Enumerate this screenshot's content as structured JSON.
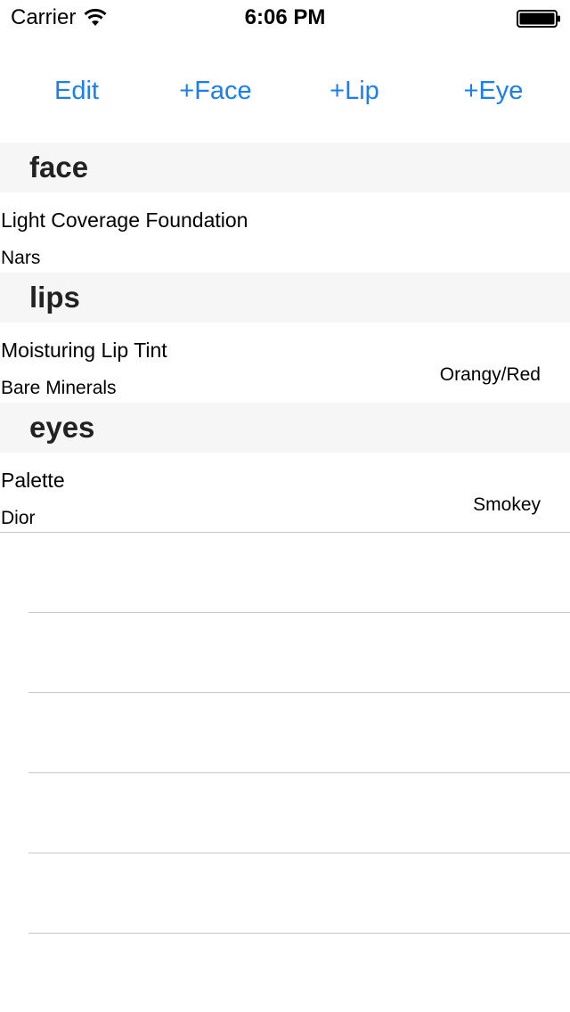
{
  "status_bar": {
    "carrier": "Carrier",
    "time": "6:06 PM"
  },
  "toolbar": {
    "edit_label": "Edit",
    "add_face_label": "+Face",
    "add_lip_label": "+Lip",
    "add_eye_label": "+Eye"
  },
  "sections": [
    {
      "header": "face",
      "items": [
        {
          "name": "Light Coverage Foundation",
          "brand": "Nars",
          "detail": ""
        }
      ]
    },
    {
      "header": "lips",
      "items": [
        {
          "name": "Moisturing Lip Tint",
          "brand": "Bare Minerals",
          "detail": "Orangy/Red"
        }
      ]
    },
    {
      "header": "eyes",
      "items": [
        {
          "name": "Palette",
          "brand": "Dior",
          "detail": "Smokey"
        }
      ]
    }
  ],
  "colors": {
    "tint": "#1a7ff5",
    "section_header_bg": "#f6f6f6",
    "separator": "#c8c7cc"
  }
}
